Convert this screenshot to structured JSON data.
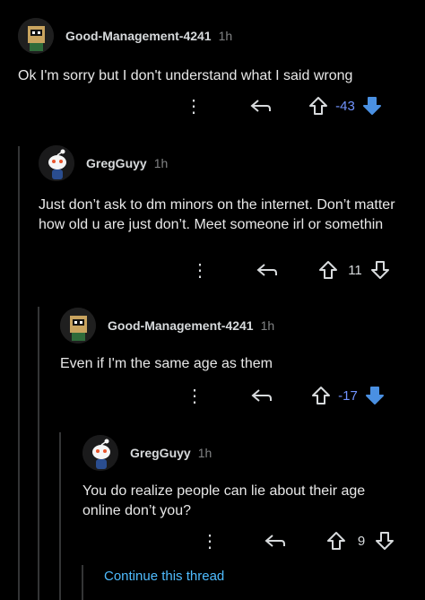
{
  "comments": [
    {
      "username": "Good-Management-4241",
      "time": "1h",
      "body": "Ok I'm sorry but I don't understand what I said wrong",
      "score": "-43",
      "vote": "down",
      "avatar": "box-head-avatar"
    },
    {
      "username": "GregGuyy",
      "time": "1h",
      "body": "Just don’t ask to dm minors on the internet. Don’t matter how old u are just don’t. Meet someone irl or somethin",
      "score": "11",
      "vote": "none",
      "avatar": "snoo-avatar"
    },
    {
      "username": "Good-Management-4241",
      "time": "1h",
      "body": "Even if I'm the same age as them",
      "score": "-17",
      "vote": "down",
      "avatar": "box-head-avatar"
    },
    {
      "username": "GregGuyy",
      "time": "1h",
      "body": "You do realize people can lie about their age online don’t you?",
      "score": "9",
      "vote": "none",
      "avatar": "snoo-avatar"
    }
  ],
  "continue_thread": "Continue this thread",
  "colors": {
    "downvote": "#4a90e2",
    "link": "#4fbcff",
    "background": "#000000"
  },
  "icons": [
    "more-icon",
    "reply-icon",
    "upvote-icon",
    "downvote-icon"
  ]
}
